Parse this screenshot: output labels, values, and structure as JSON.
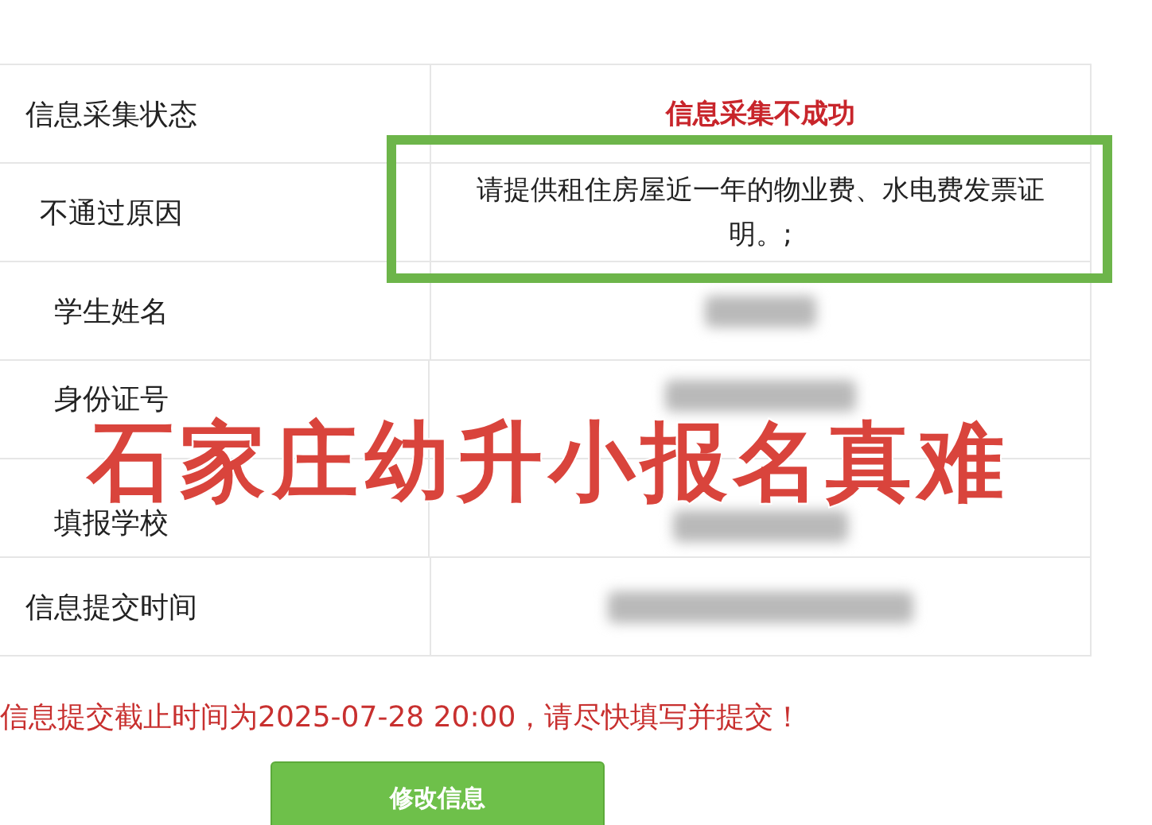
{
  "rows": [
    {
      "label": "信息采集状态",
      "kind": "status",
      "value": "信息采集不成功",
      "highlighted": false
    },
    {
      "label": "不通过原因",
      "kind": "text",
      "value": "请提供租住房屋近一年的物业费、水电费发票证明。;",
      "highlighted": true
    },
    {
      "label": "学生姓名",
      "kind": "blurred",
      "highlighted": false
    },
    {
      "label": "身份证号",
      "kind": "blurred",
      "highlighted": false
    },
    {
      "label": "填报学校",
      "kind": "blurred",
      "highlighted": false
    },
    {
      "label": "信息提交时间",
      "kind": "blurred",
      "highlighted": false
    }
  ],
  "deadline_notice": "信息提交截止时间为2025-07-28 20:00，请尽快填写并提交！",
  "button": "修改信息",
  "overlay_caption": "石家庄幼升小报名真难"
}
